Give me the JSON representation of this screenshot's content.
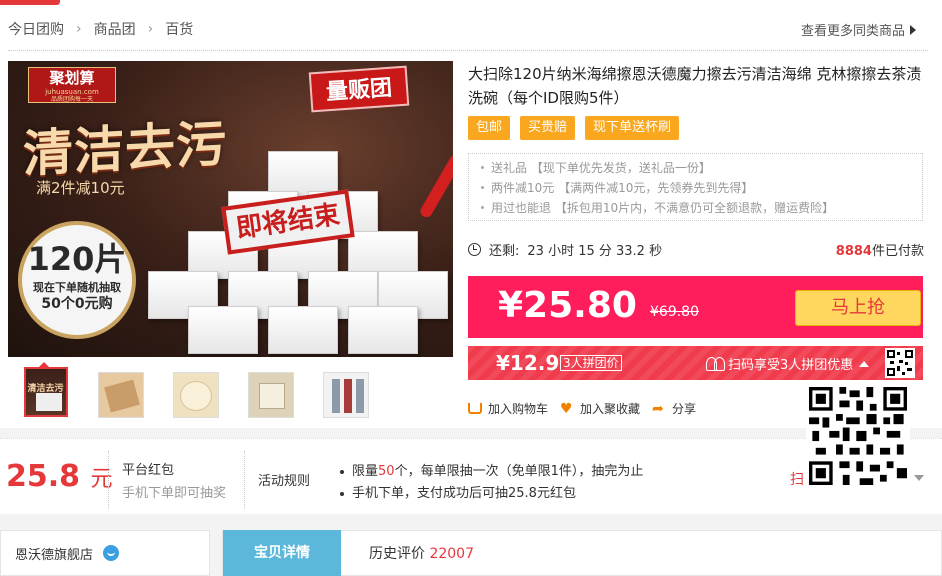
{
  "breadcrumb": [
    "今日团购",
    "商品团",
    "百货"
  ],
  "more_link": "查看更多同类商品",
  "image": {
    "logo": "聚划算",
    "logo_url": "juhuasuan.com",
    "logo_slogan": "品质团购每一天",
    "headline": "清洁去污",
    "promo": "满2件减10元",
    "volume_tag": "量贩团",
    "ending": "即将结束",
    "count": "120片",
    "count_sub1": "现在下单随机抽取",
    "count_sub2": "50个0元购"
  },
  "product": {
    "title": "大扫除120片纳米海绵擦恩沃德魔力擦去污清洁海绵 克林擦擦去茶渍洗碗（每个ID限购5件）",
    "tags": [
      "包邮",
      "买贵赔",
      "现下单送杯刷"
    ],
    "gifts": [
      "送礼品 【现下单优先发货，送礼品一份】",
      "两件减10元 【满两件减10元，先领券先到先得】",
      "用过也能退 【拆包用10片内，不满意仍可全额退款，赠运费险】"
    ],
    "timer_label": "还剩:",
    "timer_value": "23 小时 15 分 33.2 秒",
    "sold_count": "8884",
    "sold_suffix": "件已付款"
  },
  "price": {
    "current": "¥25.80",
    "original": "¥69.80",
    "buy_button": "马上抢"
  },
  "group": {
    "price": "¥12.9",
    "label": "3人拼团价",
    "scan_text": "扫码享受3人拼团优惠"
  },
  "actions": [
    "加入购物车",
    "加入聚收藏",
    "分享"
  ],
  "coupon": {
    "amount": "25.8",
    "unit": "元",
    "title": "平台红包",
    "subtitle": "手机下单即可抽奖",
    "rule_label": "活动规则",
    "rule1_pre": "限量",
    "rule1_num": "50",
    "rule1_post": "个，每单限抽一次（免单限1件），抽完为止",
    "rule2": "手机下单，支付成功后可抽25.8元红包",
    "scan_partial": "扫"
  },
  "shop": {
    "name": "恩沃德旗舰店"
  },
  "tabs": {
    "active": "宝贝详情",
    "reviews_label": "历史评价",
    "reviews_count": "22007"
  },
  "colors": {
    "accent": "#ff1d5c",
    "tag": "#f9a71e",
    "buy": "#ffd75e",
    "tab_active": "#5cb8db"
  }
}
